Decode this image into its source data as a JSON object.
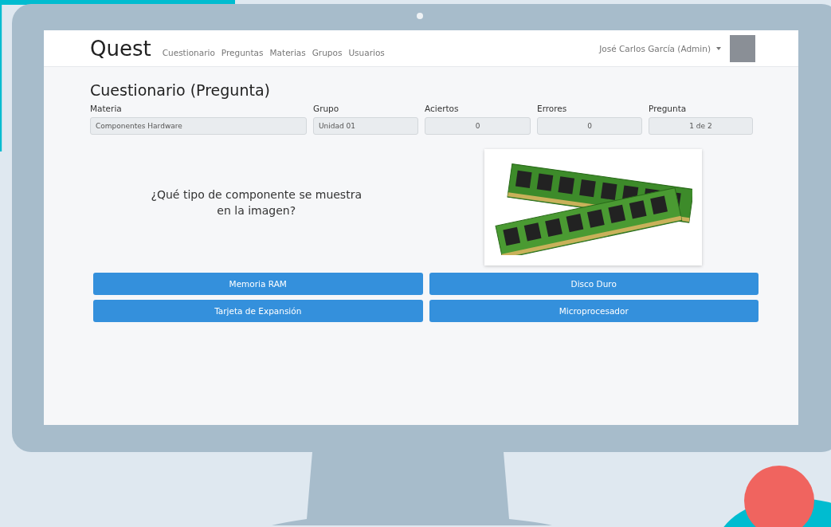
{
  "navbar": {
    "brand": "Quest",
    "links": [
      "Cuestionario",
      "Preguntas",
      "Materias",
      "Grupos",
      "Usuarios"
    ],
    "user": "José Carlos García (Admin)"
  },
  "page_title": "Cuestionario (Pregunta)",
  "fields": [
    {
      "label": "Materia",
      "value": "Componentes Hardware",
      "kind": "text"
    },
    {
      "label": "Grupo",
      "value": "Unidad 01",
      "kind": "text"
    },
    {
      "label": "Aciertos",
      "value": "0",
      "kind": "count"
    },
    {
      "label": "Errores",
      "value": "0",
      "kind": "count"
    },
    {
      "label": "Pregunta",
      "value": "1 de 2",
      "kind": "count"
    }
  ],
  "question": "¿Qué tipo de componente se muestra en la imagen?",
  "answers": [
    "Memoria RAM",
    "Disco Duro",
    "Tarjeta de Expansión",
    "Microprocesador"
  ]
}
